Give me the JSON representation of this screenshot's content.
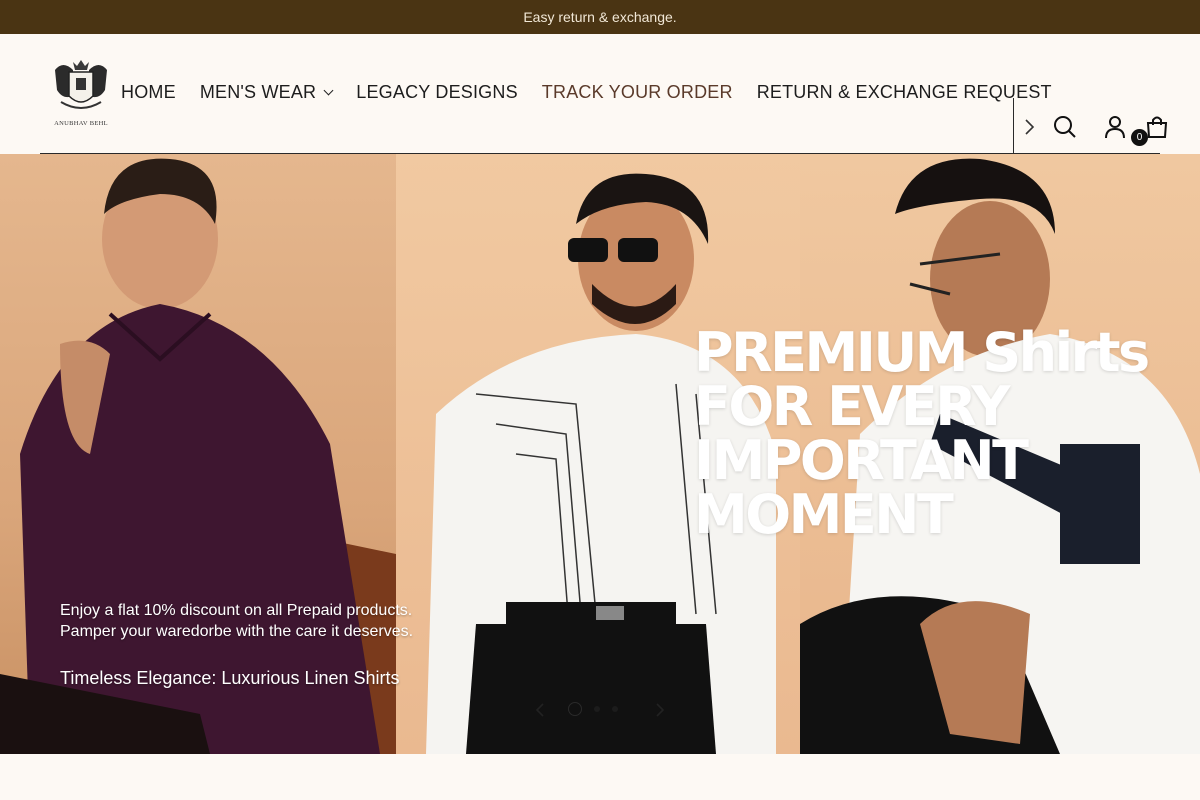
{
  "announcement": "Easy return & exchange.",
  "brand": {
    "logo_text": "ANUBHAV BEHL"
  },
  "nav": {
    "items": [
      {
        "label": "HOME",
        "has_dropdown": false,
        "active": false
      },
      {
        "label": "MEN'S WEAR",
        "has_dropdown": true,
        "active": false
      },
      {
        "label": "LEGACY DESIGNS",
        "has_dropdown": false,
        "active": false
      },
      {
        "label": "TRACK YOUR ORDER",
        "has_dropdown": false,
        "active": true
      },
      {
        "label": "RETURN & EXCHANGE REQUEST",
        "has_dropdown": false,
        "active": false
      }
    ]
  },
  "header_icons": {
    "next": "chevron-right-icon",
    "search": "search-icon",
    "account": "user-icon",
    "cart": "bag-icon"
  },
  "cart": {
    "count": "0"
  },
  "hero": {
    "headline": [
      "PREMIUM Shirts",
      "FOR EVERY",
      "IMPORTANT",
      "MOMENT"
    ],
    "promo_line1": "Enjoy a flat 10% discount on all Prepaid products.",
    "promo_line2": "Pamper your waredorbe with the care it deserves.",
    "subtitle": "Timeless Elegance: Luxurious Linen Shirts",
    "slides_total": 3,
    "active_slide": 1
  },
  "colors": {
    "announce_bg": "#4a3413",
    "accent_nav": "#5a3a2a",
    "page_bg": "#fdf9f4"
  }
}
